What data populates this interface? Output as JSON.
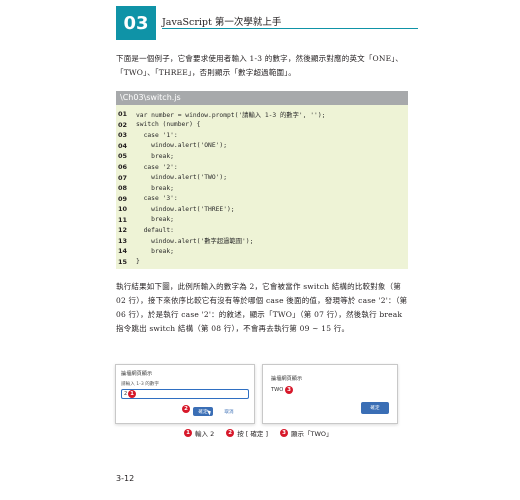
{
  "header": {
    "chapter_number": "03",
    "title": "JavaScript 第一次學就上手"
  },
  "intro_paragraph": "下面是一個例子，它會要求使用者輸入 1-3 的數字，然後顯示對應的英文「ONE」、「TWO」、「THREE」，否則顯示「數字超過範圍」。",
  "code": {
    "filename": "\\Ch03\\switch.js",
    "lines": [
      {
        "number": "01",
        "text": "var number = window.prompt('請輸入 1-3 的數字', '');"
      },
      {
        "number": "02",
        "text": "switch (number) {"
      },
      {
        "number": "03",
        "text": "  case '1':"
      },
      {
        "number": "04",
        "text": "    window.alert('ONE');"
      },
      {
        "number": "05",
        "text": "    break;"
      },
      {
        "number": "06",
        "text": "  case '2':"
      },
      {
        "number": "07",
        "text": "    window.alert('TWO');"
      },
      {
        "number": "08",
        "text": "    break;"
      },
      {
        "number": "09",
        "text": "  case '3':"
      },
      {
        "number": "10",
        "text": "    window.alert('THREE');"
      },
      {
        "number": "11",
        "text": "    break;"
      },
      {
        "number": "12",
        "text": "  default:"
      },
      {
        "number": "13",
        "text": "    window.alert('數字超過範圍');"
      },
      {
        "number": "14",
        "text": "    break;"
      },
      {
        "number": "15",
        "text": "}"
      }
    ]
  },
  "result_paragraph": "執行結果如下圖，此例所輸入的數字為 2，它會被當作 switch 結構的比較對象（第 02 行），接下來依序比較它有沒有等於哪個 case 後面的值，發現等於 case '2'：（第 06 行），於是執行 case '2'：的敘述，顯示「TWO」（第 07 行），然後執行 break 指令跳出 switch 結構（第 08 行），不會再去執行第 09 ~ 15 行。",
  "figure": {
    "prompt_dialog": {
      "title": "論壇網頁顯示",
      "prompt": "請輸入 1-3 的數字",
      "input_value": "2",
      "ok_label": "確定",
      "cancel_label": "取消"
    },
    "alert_dialog": {
      "title": "論壇網頁顯示",
      "message": "TWO",
      "ok_label": "確定"
    },
    "badges": [
      "1",
      "2",
      "3"
    ],
    "captions": [
      "輸入 2",
      "按 [ 確定 ]",
      "顯示「TWO」"
    ]
  },
  "page_number": "3-12",
  "colors": {
    "accent": "#0f93a7",
    "code_bg": "#eef3d6",
    "badge": "#d7182a",
    "button": "#3a6eb5"
  }
}
